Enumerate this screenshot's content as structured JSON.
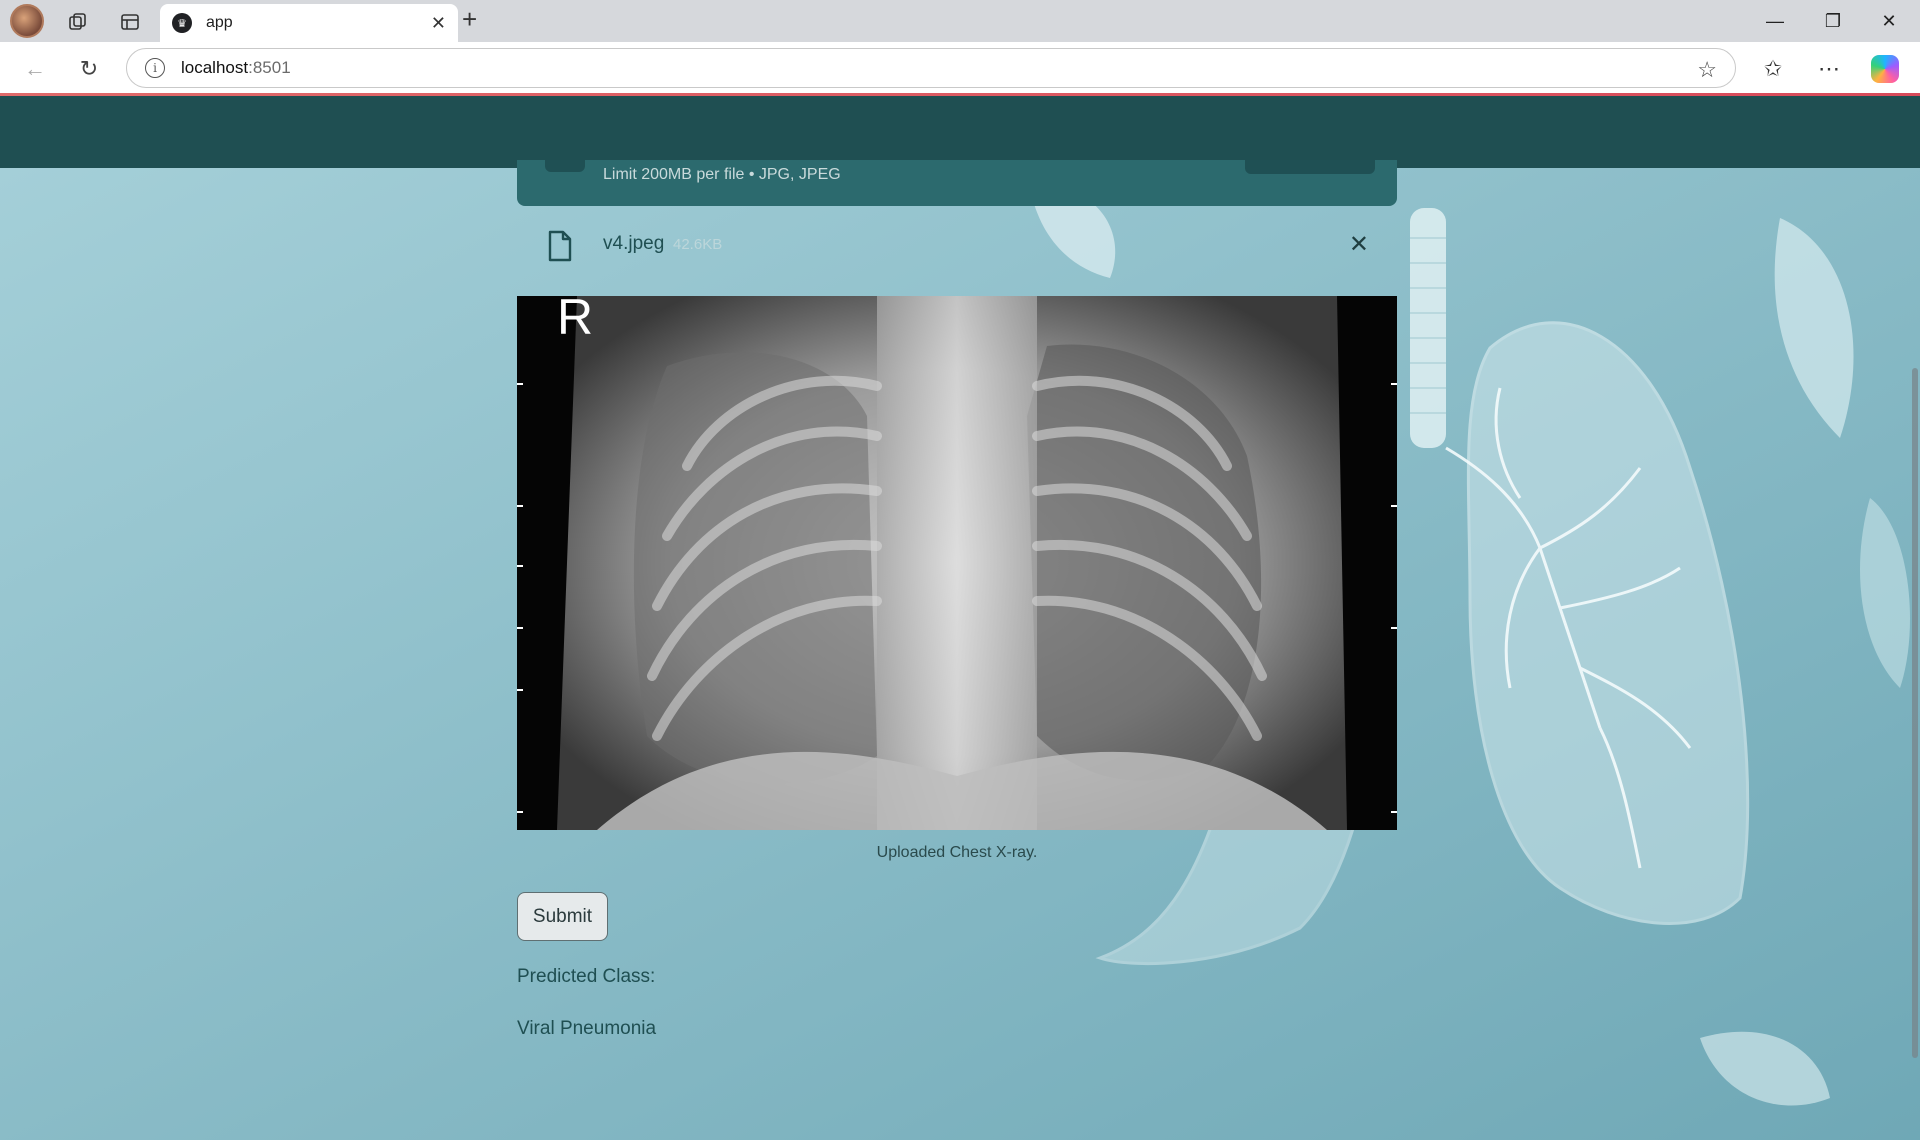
{
  "browser": {
    "tab_title": "app",
    "url_host": "localhost",
    "url_port": ":8501"
  },
  "uploader": {
    "hint": "Limit 200MB per file • JPG, JPEG"
  },
  "file": {
    "name": "v4.jpeg",
    "size": "42.6KB"
  },
  "image": {
    "marker": "R",
    "caption": "Uploaded Chest X-ray."
  },
  "form": {
    "submit_label": "Submit"
  },
  "result": {
    "label": "Predicted Class:",
    "value": "Viral Pneumonia"
  },
  "colors": {
    "header": "#1f4f52",
    "page_bg": "#9cc8d2",
    "text": "#1f4f52"
  }
}
